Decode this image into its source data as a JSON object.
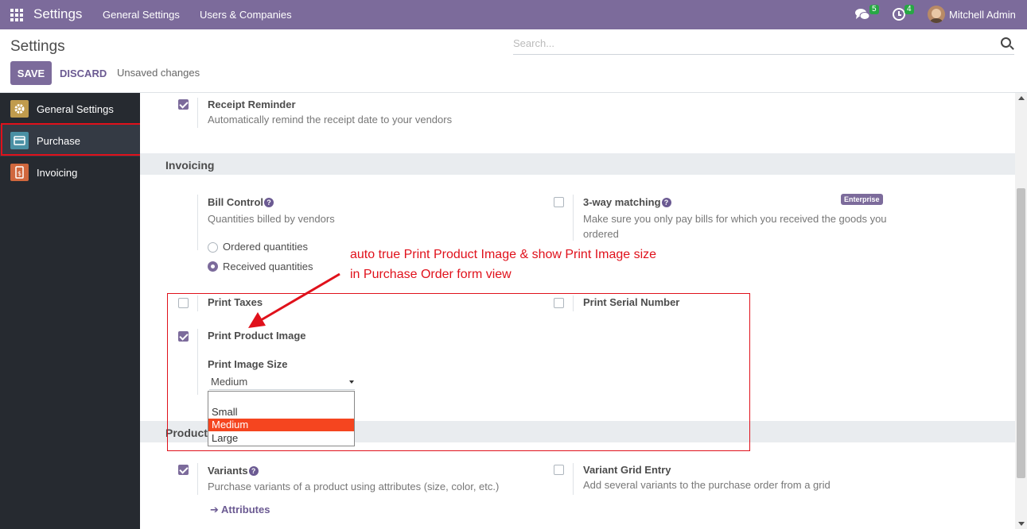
{
  "navbar": {
    "brand": "Settings",
    "menus": [
      "General Settings",
      "Users & Companies"
    ],
    "chat_count": "5",
    "activity_count": "4",
    "user_name": "Mitchell Admin",
    "bg_color": "#7c6b9b"
  },
  "control_panel": {
    "title": "Settings",
    "search_placeholder": "Search...",
    "save_label": "SAVE",
    "discard_label": "DISCARD",
    "status": "Unsaved changes"
  },
  "sidebar": {
    "items": [
      {
        "label": "General Settings",
        "icon": "gear-icon",
        "color": "#c09b4d"
      },
      {
        "label": "Purchase",
        "icon": "purchase-card-icon",
        "color": "#4a90a4"
      },
      {
        "label": "Invoicing",
        "icon": "invoice-icon",
        "color": "#d0673d"
      }
    ],
    "active": "Purchase"
  },
  "settings": {
    "receipt_reminder": {
      "title": "Receipt Reminder",
      "desc": "Automatically remind the receipt date to your vendors",
      "checked": true
    },
    "invoicing_section": "Invoicing",
    "bill_control": {
      "title": "Bill Control",
      "desc": "Quantities billed by vendors",
      "options": [
        "Ordered quantities",
        "Received quantities"
      ],
      "selected": "Received quantities"
    },
    "three_way": {
      "title": "3-way matching",
      "desc_line1": "Make sure you only pay bills for which you received the goods you",
      "desc_line2": "ordered",
      "badge": "Enterprise",
      "checked": false
    },
    "print_taxes": {
      "title": "Print Taxes",
      "checked": false
    },
    "print_serial": {
      "title": "Print Serial Number",
      "checked": false
    },
    "print_product_image": {
      "title": "Print Product Image",
      "checked": true
    },
    "print_image_size": {
      "label": "Print Image Size",
      "value": "Medium",
      "options": [
        "",
        "Small",
        "Medium",
        "Large"
      ]
    },
    "products_section": "Products",
    "variants": {
      "title": "Variants",
      "desc": "Purchase variants of a product using attributes (size, color, etc.)",
      "checked": true,
      "link": "Attributes"
    },
    "variant_grid": {
      "title": "Variant Grid Entry",
      "desc": "Add several variants to the purchase order from a grid",
      "checked": false
    }
  },
  "annotation": {
    "line1": "auto true Print Product Image & show Print Image size",
    "line2": "in Purchase Order form view",
    "color": "#e0111b"
  }
}
